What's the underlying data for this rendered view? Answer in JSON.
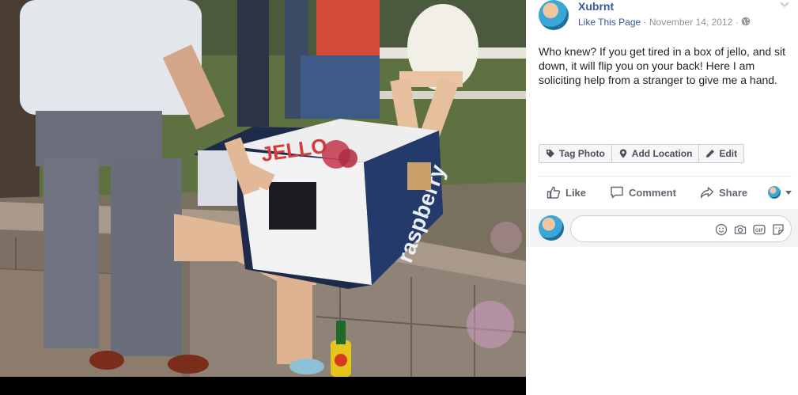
{
  "post": {
    "page_name": "Xubrnt",
    "like_page": "Like This Page",
    "separator": "·",
    "date": "November 14, 2012",
    "separator2": "·",
    "audience_icon": "globe-icon",
    "caption": "Who knew? If you get tired in a box of jello, and sit down, it will flip you on your back! Here I am soliciting help from a stranger to give me a hand."
  },
  "photo": {
    "box_texts": [
      "JELLO",
      "raspberry"
    ]
  },
  "tag_bar": {
    "tag_photo": "Tag Photo",
    "add_location": "Add Location",
    "edit": "Edit"
  },
  "actions": {
    "like": "Like",
    "comment": "Comment",
    "share": "Share"
  },
  "comment": {
    "placeholder": "",
    "icons": [
      "emoji-icon",
      "camera-icon",
      "gif-icon",
      "sticker-icon"
    ]
  },
  "colors": {
    "link": "#385898",
    "meta": "#90949c",
    "text": "#1d2129",
    "button_text": "#4b4f56",
    "action_text": "#606770"
  }
}
